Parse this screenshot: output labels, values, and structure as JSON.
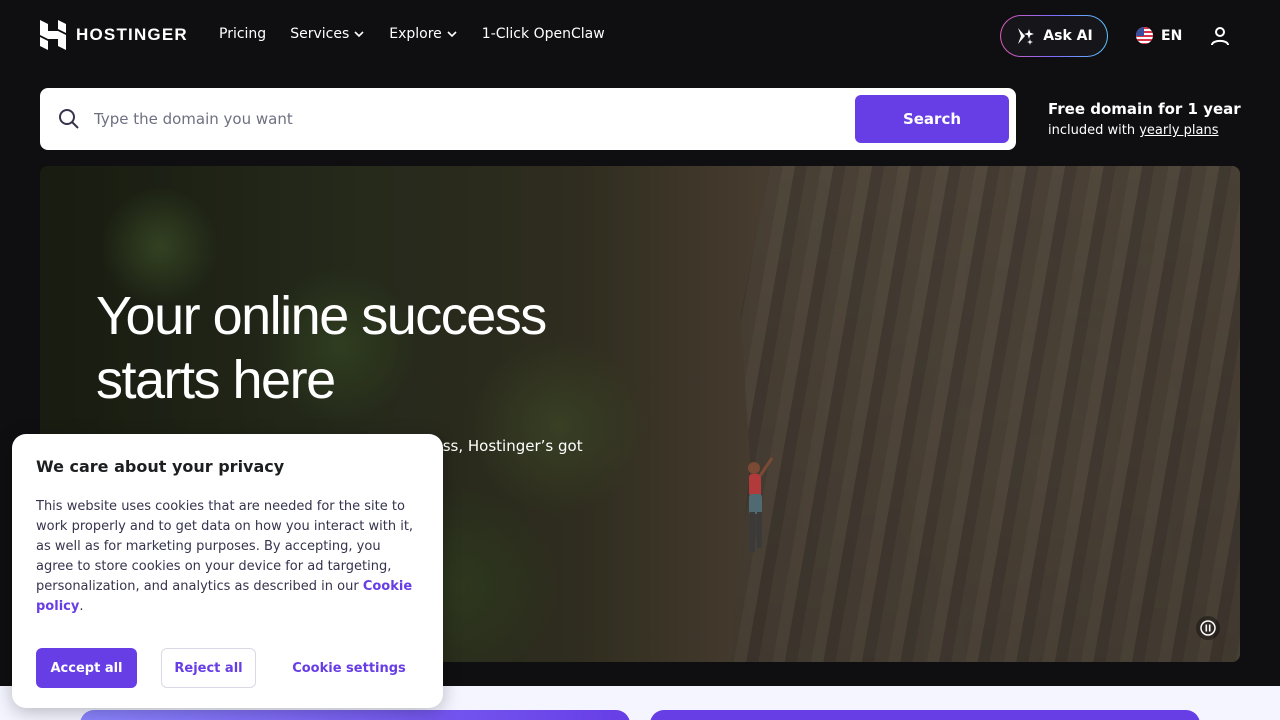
{
  "header": {
    "logo_text": "HOSTINGER",
    "nav": {
      "pricing": "Pricing",
      "services": "Services",
      "explore": "Explore",
      "openclaw": "1-Click OpenClaw"
    },
    "ask_ai": "Ask AI",
    "language": "EN"
  },
  "domain_search": {
    "placeholder": "Type the domain you want",
    "value": "",
    "button": "Search",
    "promo_title": "Free domain for 1 year",
    "promo_prefix": "included with ",
    "promo_link": "yearly plans"
  },
  "hero": {
    "title_line1": "Your online success",
    "title_line2": "starts here",
    "subtitle_visible": "ness, Hostinger’s got"
  },
  "cookie_banner": {
    "title": "We care about your privacy",
    "body": "This website uses cookies that are needed for the site to work properly and to get data on how you interact with it, as well as for marketing purposes. By accepting, you agree to store cookies on your device for ad targeting, personalization, and analytics as described in our ",
    "link": "Cookie policy",
    "period": ".",
    "accept": "Accept all",
    "reject": "Reject all",
    "settings": "Cookie settings"
  },
  "colors": {
    "brand": "#673de6",
    "background": "#0f0f12"
  }
}
